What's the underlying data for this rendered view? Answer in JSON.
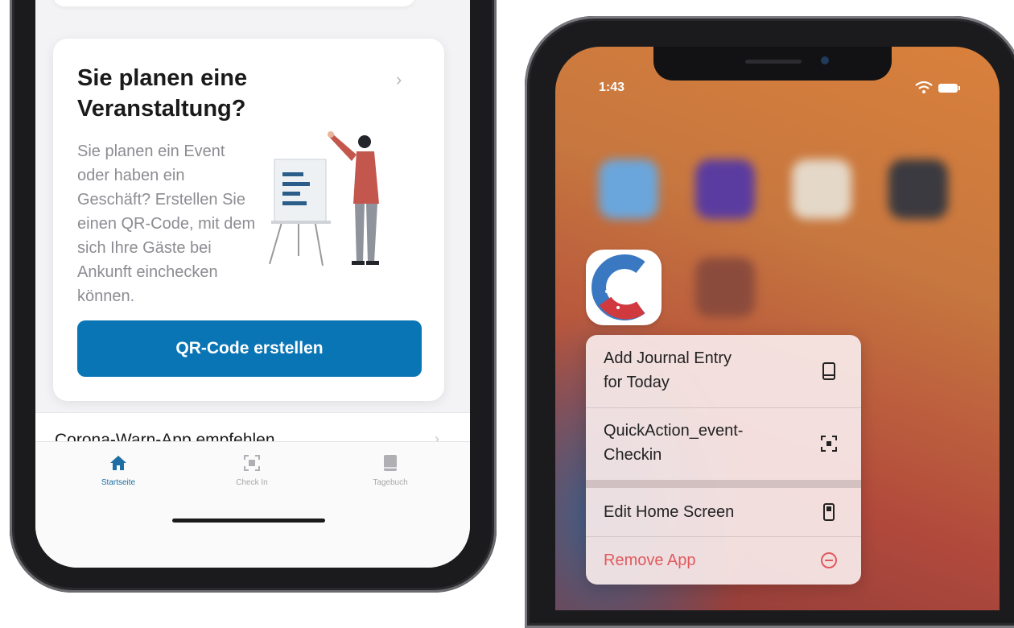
{
  "left_screen": {
    "card": {
      "title": "Sie planen eine Veranstaltung?",
      "chevron": "›",
      "body": "Sie planen ein Event oder haben ein Geschäft? Erstellen Sie einen QR-Code, mit dem sich Ihre Gäste bei Ankunft einchecken können.",
      "button_label": "QR-Code erstellen",
      "illustration": "presenter-at-flipchart-illustration"
    },
    "recommend_row": {
      "label": "Corona-Warn-App empfehlen",
      "chevron": "›"
    },
    "tabbar": {
      "tabs": [
        {
          "label": "Startseite",
          "icon": "home-icon",
          "active": true
        },
        {
          "label": "Check In",
          "icon": "qr-scan-icon",
          "active": false
        },
        {
          "label": "Tagebuch",
          "icon": "book-icon",
          "active": false
        }
      ]
    },
    "colors": {
      "accent": "#0a75b4",
      "active_tab": "#1d6fa3"
    }
  },
  "right_screen": {
    "status_bar": {
      "time": "1:43",
      "icons": [
        "wifi-icon",
        "battery-icon"
      ]
    },
    "app_icon": "corona-warn-app-icon",
    "context_menu": {
      "items": [
        {
          "label_line1": "Add Journal Entry",
          "label_line2": "for Today",
          "icon": "book-icon"
        },
        {
          "label_line1": "QuickAction_event-",
          "label_line2": "Checkin",
          "icon": "qr-scan-icon"
        },
        {
          "label_line1": "Edit Home Screen",
          "label_line2": "",
          "icon": "phone-icon"
        },
        {
          "label_line1": "Remove App",
          "label_line2": "",
          "icon": "minus-circle-icon",
          "destructive": true
        }
      ]
    },
    "colors": {
      "destructive": "#e05a5e"
    }
  }
}
